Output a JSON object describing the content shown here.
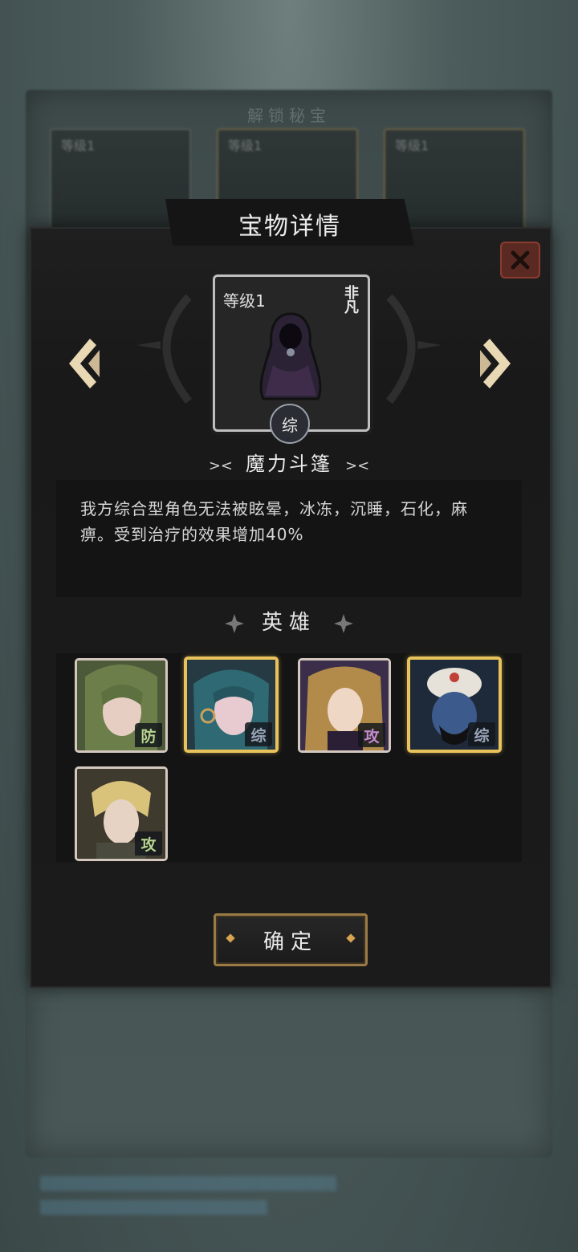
{
  "background": {
    "title": "解锁秘宝",
    "cards": [
      {
        "level": "等级1"
      },
      {
        "level": "等级1"
      },
      {
        "level": "等级1"
      }
    ]
  },
  "dialog": {
    "title": "宝物详情",
    "close_icon": "close-x-icon",
    "treasure": {
      "level": "等级1",
      "rarity": "非凡",
      "type_badge": "综",
      "name": "魔力斗篷",
      "icon": "cloak-icon",
      "description": "我方综合型角色无法被眩晕，冰冻，沉睡，石化，麻痹。受到治疗的效果增加40%"
    },
    "heroes_title": "英雄",
    "heroes": [
      {
        "name": "elf-hero",
        "role": "防",
        "role_color": "#b7d38d",
        "frame": "silver"
      },
      {
        "name": "siren-hero",
        "role": "综",
        "role_color": "#9aa4b8",
        "frame": "gold"
      },
      {
        "name": "blonde-hero",
        "role": "攻",
        "role_color": "#c48ad2",
        "frame": "silver"
      },
      {
        "name": "genie-hero",
        "role": "综",
        "role_color": "#9aa4b8",
        "frame": "gold"
      },
      {
        "name": "swordsman-hero",
        "role": "攻",
        "role_color": "#b7d38d",
        "frame": "silver"
      }
    ],
    "confirm_label": "确定"
  },
  "colors": {
    "gold_frame": "#e8c25a",
    "silver_frame": "#d4c8be",
    "close_button": "#5a2a22",
    "confirm_border": "#9b7b45"
  }
}
